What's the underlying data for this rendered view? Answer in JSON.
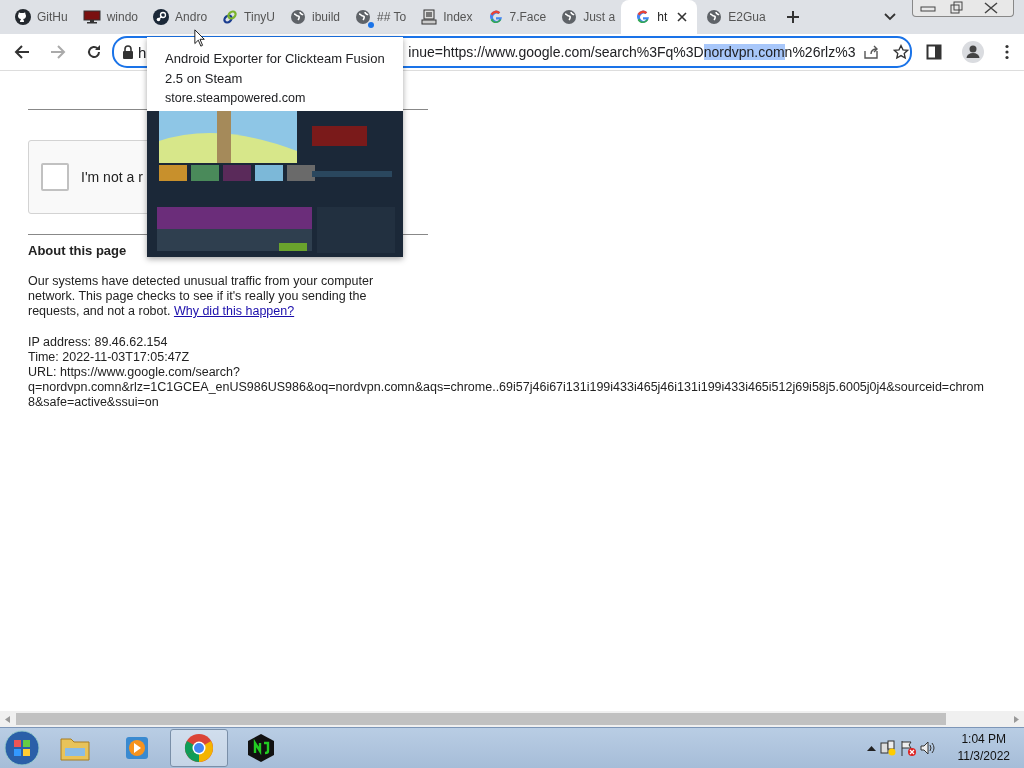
{
  "tabs": [
    {
      "label": "GitHu",
      "kind": "github",
      "selected": false,
      "alert": false
    },
    {
      "label": "windo",
      "kind": "monitor",
      "selected": false,
      "alert": false
    },
    {
      "label": "Andro",
      "kind": "steam",
      "selected": false,
      "alert": false
    },
    {
      "label": "TinyU",
      "kind": "link",
      "selected": false,
      "alert": false
    },
    {
      "label": "ibuild",
      "kind": "globe",
      "selected": false,
      "alert": false
    },
    {
      "label": "## To",
      "kind": "globe",
      "selected": false,
      "alert": true
    },
    {
      "label": "Index",
      "kind": "computer",
      "selected": false,
      "alert": false
    },
    {
      "label": "7.Face",
      "kind": "google",
      "selected": false,
      "alert": false
    },
    {
      "label": "Just a",
      "kind": "globe",
      "selected": false,
      "alert": false
    },
    {
      "label": "ht",
      "kind": "google",
      "selected": true,
      "alert": false
    },
    {
      "label": "E2Gua",
      "kind": "globe",
      "selected": false,
      "alert": false
    }
  ],
  "address_bar": {
    "start": "h",
    "after_tooltip": "inue=https://www.google.com/search%3Fq%3D",
    "highlighted": "nordvpn.com",
    "end": "n%26rlz%3"
  },
  "tooltip": {
    "title": "Android Exporter for Clickteam Fusion 2.5 on Steam",
    "domain": "store.steampowered.com"
  },
  "captcha": {
    "label": "I'm not a r",
    "checked": false
  },
  "about": {
    "heading": "About this page",
    "text": "Our systems have detected unusual traffic from your computer network. This page checks to see if it's really you sending the requests, and not a robot.",
    "link": "Why did this happen?",
    "ip": "IP address: 89.46.62.154",
    "time": "Time: 2022-11-03T17:05:47Z",
    "url_lines": [
      "URL: https://www.google.com/search?",
      "q=nordvpn.comn&rlz=1C1GCEA_enUS986US986&oq=nordvpn.comn&aqs=chrome..69i57j46i67i131i199i433i465j46i131i199i433i465i512j69i58j5.6005j0j4&sourceid=chrom",
      "8&safe=active&ssui=on"
    ]
  },
  "taskbar": {
    "apps": [
      {
        "kind": "folder",
        "selected": false
      },
      {
        "kind": "media",
        "selected": false
      },
      {
        "kind": "chrome",
        "selected": true
      },
      {
        "kind": "nj",
        "selected": false
      }
    ],
    "time": "1:04 PM",
    "date": "11/3/2022"
  }
}
